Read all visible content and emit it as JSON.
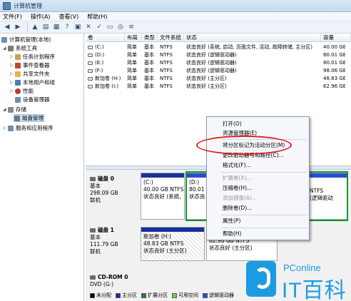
{
  "window": {
    "title": "计算机管理"
  },
  "menu": [
    "文件(F)",
    "操作(A)",
    "查看(V)",
    "帮助(H)"
  ],
  "tree": [
    {
      "label": "计算机管理(本地)",
      "level": 0
    },
    {
      "label": "系统工具",
      "level": 1
    },
    {
      "label": "任务计划程序",
      "level": 2
    },
    {
      "label": "事件查看器",
      "level": 2
    },
    {
      "label": "共享文件夹",
      "level": 2
    },
    {
      "label": "本地用户和组",
      "level": 2
    },
    {
      "label": "性能",
      "level": 2
    },
    {
      "label": "设备管理器",
      "level": 2
    },
    {
      "label": "存储",
      "level": 1
    },
    {
      "label": "磁盘管理",
      "level": 2
    },
    {
      "label": "服务和应用程序",
      "level": 1
    }
  ],
  "table": {
    "headers": [
      "卷",
      "布局",
      "类型",
      "文件系统",
      "状态",
      "容量"
    ],
    "rows": [
      [
        "(C:)",
        "简单",
        "基本",
        "NTFS",
        "状态良好 (系统, 启动, 页面文件, 活动, 故障转储, 主分区)",
        "40.00 GB"
      ],
      [
        "(D:)",
        "简单",
        "基本",
        "NTFS",
        "状态良好 (逻辑驱动器)",
        "80.01 GB"
      ],
      [
        "(E:)",
        "简单",
        "基本",
        "NTFS",
        "状态良好 (逻辑驱动器)",
        "80.01 GB"
      ],
      [
        "(F:)",
        "简单",
        "基本",
        "NTFS",
        "状态良好 (逻辑驱动器)",
        "98.06 GB"
      ],
      [
        "新加卷 (H:)",
        "简单",
        "基本",
        "NTFS",
        "状态良好 (主分区)",
        "48.83 GB"
      ],
      [
        "新加卷 (I:)",
        "简单",
        "基本",
        "NTFS",
        "状态良好 (主分区)",
        "62.96 GB"
      ]
    ]
  },
  "disks": {
    "disk0": {
      "name": "磁盘 0",
      "type": "基本",
      "size": "298.09 GB",
      "status": "联机"
    },
    "disk1": {
      "name": "磁盘 1",
      "type": "基本",
      "size": "111.79 GB",
      "status": "联机"
    },
    "cdrom": {
      "name": "CD-ROM 0",
      "label": "DVD (G:)"
    }
  },
  "partitions": {
    "c": {
      "name": "(C:)",
      "size": "40.00 GB NTFS",
      "status": "状态良好 (系统,"
    },
    "d": {
      "name": "(D:)",
      "size": "80.01",
      "status": "状态良"
    },
    "e": {
      "size": "NTFS",
      "status": "(逻辑驱动"
    },
    "h": {
      "name": "新加卷 (H:)",
      "size": "48.83 GB NTFS",
      "status": "状态良好 (主分区)"
    },
    "i": {
      "size": "62.96 GB NTFS",
      "status": "状态良好 (主分区)"
    }
  },
  "legend": [
    {
      "label": "未分配",
      "color": "#000000"
    },
    {
      "label": "主分区",
      "color": "#1b2f9c"
    },
    {
      "label": "扩展分区",
      "color": "#1e8a2a"
    },
    {
      "label": "可用空间",
      "color": "#7ec850"
    },
    {
      "label": "逻辑驱动器",
      "color": "#2b4bd6"
    }
  ],
  "context_menu": [
    {
      "label": "打开(O)",
      "enabled": true
    },
    {
      "label": "资源管理器(E)",
      "enabled": true
    },
    {
      "label": "将分区标记为活动分区(M)",
      "enabled": true
    },
    {
      "label": "更改驱动器号和路径(C)...",
      "enabled": true
    },
    {
      "label": "格式化(F)...",
      "enabled": true
    },
    {
      "label": "扩展卷(X)...",
      "enabled": false
    },
    {
      "label": "压缩卷(H)...",
      "enabled": true
    },
    {
      "label": "添加镜像(A)...",
      "enabled": false
    },
    {
      "label": "删除卷(D)...",
      "enabled": true
    },
    {
      "label": "属性(P)",
      "enabled": true
    },
    {
      "label": "帮助(H)",
      "enabled": true
    }
  ],
  "watermark": {
    "brand": "PConline",
    "name": "IT百科"
  }
}
